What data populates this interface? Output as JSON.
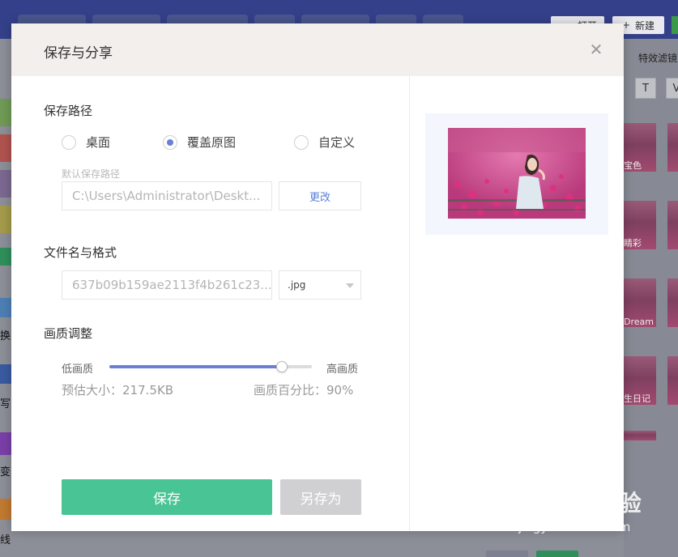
{
  "background": {
    "toolbar_buttons": {
      "open_label": "打开",
      "new_label": "新建"
    },
    "right_panel": {
      "header_label": "特效滤镜",
      "tabs": [
        "T",
        "V"
      ],
      "filters": [
        "宝色",
        "睛彩",
        "Dream",
        "生日记"
      ]
    },
    "left_rail_labels": [
      "换",
      "写",
      "变",
      "线"
    ]
  },
  "dialog": {
    "title": "保存与分享",
    "close_icon": "close-icon",
    "save_path": {
      "section_title": "保存路径",
      "options": [
        {
          "label": "桌面",
          "selected": false
        },
        {
          "label": "覆盖原图",
          "selected": true
        },
        {
          "label": "自定义",
          "selected": false
        }
      ],
      "hint": "默认保存路径",
      "path_value": "C:\\Users\\Administrator\\Deskt...",
      "change_button": "更改"
    },
    "filename": {
      "section_title": "文件名与格式",
      "name_value": "637b09b159ae2113f4b261c23...",
      "format_value": ".jpg"
    },
    "quality": {
      "section_title": "画质调整",
      "low_label": "低画质",
      "high_label": "高画质",
      "level_percent": 85,
      "estimated_size": "预估大小：217.5KB",
      "quality_percent_text": "画质百分比：90%"
    },
    "actions": {
      "save": "保存",
      "save_as": "另存为"
    },
    "colors": {
      "accent": "#6b7fd7",
      "save_green": "#48c495",
      "disabled": "#d0d0d3"
    }
  },
  "watermark": {
    "logo": "Baidu经验",
    "url": "jingyan.baidu.com"
  }
}
